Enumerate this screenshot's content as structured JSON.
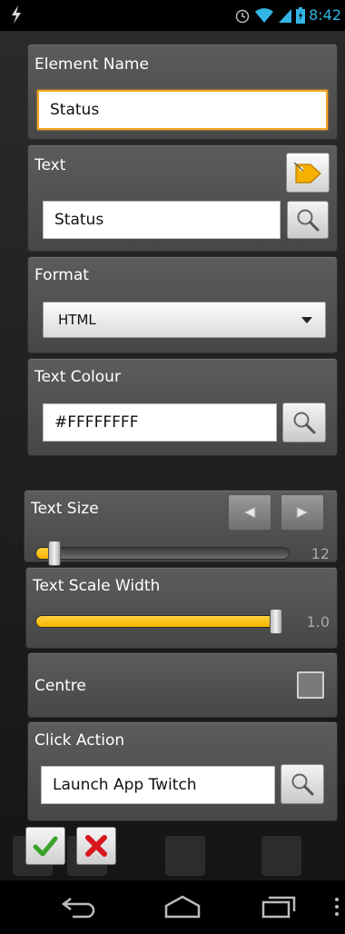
{
  "status_bar": {
    "time": "8:42",
    "icons": [
      "usb-debug-icon",
      "alarm-icon",
      "wifi-icon",
      "signal-icon",
      "battery-icon"
    ]
  },
  "element_name": {
    "label": "Element Name",
    "value": "Status"
  },
  "text": {
    "label": "Text",
    "value": "Status",
    "tag_button_icon": "tag-icon",
    "lookup_button_icon": "magnifier-icon"
  },
  "format": {
    "label": "Format",
    "selected": "HTML"
  },
  "text_colour": {
    "label": "Text Colour",
    "value": "#FFFFFFFF",
    "lookup_button_icon": "magnifier-icon"
  },
  "text_size": {
    "label": "Text Size",
    "value": "12",
    "level": 0.0
  },
  "text_scale_width": {
    "label": "Text Scale Width",
    "value": "1.0",
    "level": 1.0
  },
  "centre": {
    "label": "Centre",
    "checked": false
  },
  "click_action": {
    "label": "Click Action",
    "value": "Launch App Twitch",
    "lookup_button_icon": "magnifier-icon"
  },
  "actions": {
    "ok_icon": "checkmark-icon",
    "cancel_icon": "red-x-icon"
  },
  "colors": {
    "accent": "#f5b300",
    "focus": "#f5a623",
    "time": "#33b5e5"
  }
}
